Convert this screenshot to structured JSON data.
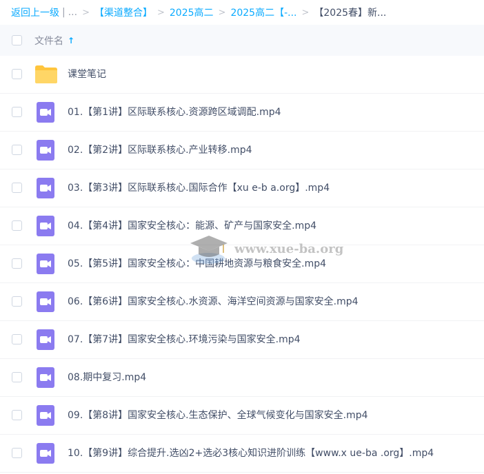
{
  "breadcrumb": {
    "back": "返回上一级",
    "divider": "|",
    "ellipsis": "...",
    "sep": ">",
    "items": [
      "【渠道整合】",
      "2025高二",
      "2025高二【-..."
    ],
    "current": "【2025春】新..."
  },
  "header": {
    "column_label": "文件名",
    "sort_arrow": "↑"
  },
  "rows": [
    {
      "name": "课堂笔记",
      "type": "folder"
    },
    {
      "name": "01.【第1讲】区际联系核心.资源跨区域调配.mp4",
      "type": "video"
    },
    {
      "name": "02.【第2讲】区际联系核心.产业转移.mp4",
      "type": "video"
    },
    {
      "name": "03.【第3讲】区际联系核心.国际合作【xu e-b a.org】.mp4",
      "type": "video"
    },
    {
      "name": "04.【第4讲】国家安全核心：能源、矿产与国家安全.mp4",
      "type": "video"
    },
    {
      "name": "05.【第5讲】国家安全核心：中国耕地资源与粮食安全.mp4",
      "type": "video"
    },
    {
      "name": "06.【第6讲】国家安全核心.水资源、海洋空间资源与国家安全.mp4",
      "type": "video"
    },
    {
      "name": "07.【第7讲】国家安全核心.环境污染与国家安全.mp4",
      "type": "video"
    },
    {
      "name": "08.期中复习.mp4",
      "type": "video"
    },
    {
      "name": "09.【第8讲】国家安全核心.生态保护、全球气候变化与国家安全.mp4",
      "type": "video"
    },
    {
      "name": "10.【第9讲】综合提升.选凶2+选必3核心知识进阶训练【www.x ue-ba .org】.mp4",
      "type": "video"
    }
  ],
  "watermark": {
    "text": "www.xue-ba.org"
  },
  "colors": {
    "accent": "#09aaff",
    "folder": "#ffc53d",
    "video": "#8b7bf0"
  }
}
